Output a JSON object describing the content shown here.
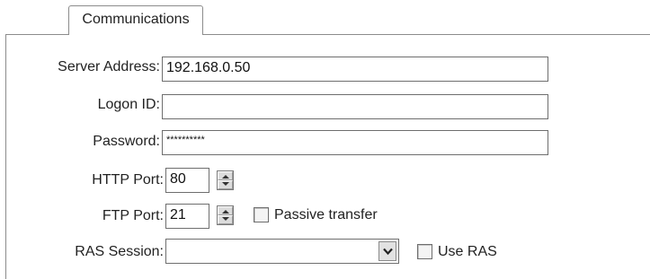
{
  "tab": {
    "label": "Communications"
  },
  "form": {
    "server_address": {
      "label": "Server Address:",
      "value": "192.168.0.50"
    },
    "logon_id": {
      "label": "Logon ID:",
      "value": ""
    },
    "password": {
      "label": "Password:",
      "value": "**********"
    },
    "http_port": {
      "label": "HTTP Port:",
      "value": "80"
    },
    "ftp_port": {
      "label": "FTP Port:",
      "value": "21"
    },
    "passive_transfer": {
      "label": "Passive transfer",
      "checked": false
    },
    "ras_session": {
      "label": "RAS Session:",
      "value": ""
    },
    "use_ras": {
      "label": "Use RAS",
      "checked": false
    }
  },
  "icons": {
    "spinner": "up-down-arrows-icon",
    "dropdown": "chevron-down-icon"
  }
}
